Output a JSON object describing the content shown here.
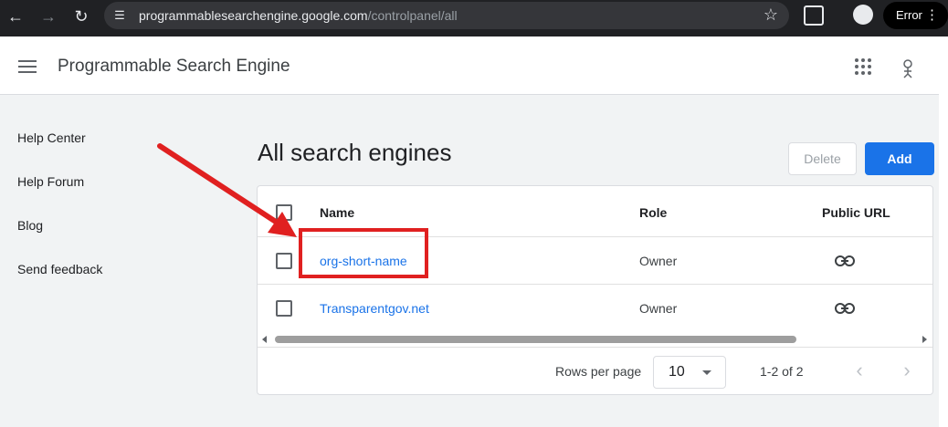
{
  "browser": {
    "url_host": "programmablesearchengine.google.com",
    "url_path": "/controlpanel/all",
    "profile_label": "Error"
  },
  "header": {
    "title": "Programmable Search Engine"
  },
  "sidebar": {
    "items": [
      {
        "label": "Help Center"
      },
      {
        "label": "Help Forum"
      },
      {
        "label": "Blog"
      },
      {
        "label": "Send feedback"
      }
    ]
  },
  "main": {
    "title": "All search engines",
    "delete_label": "Delete",
    "add_label": "Add",
    "columns": {
      "name": "Name",
      "role": "Role",
      "public_url": "Public URL"
    },
    "rows": [
      {
        "name": "org-short-name",
        "role": "Owner"
      },
      {
        "name": "Transparentgov.net",
        "role": "Owner"
      }
    ],
    "pagination": {
      "rows_per_page_label": "Rows per page",
      "rows_per_page": "10",
      "range": "1-2 of 2"
    }
  },
  "colors": {
    "accent": "#1a73e8",
    "annotation": "#e02020"
  }
}
